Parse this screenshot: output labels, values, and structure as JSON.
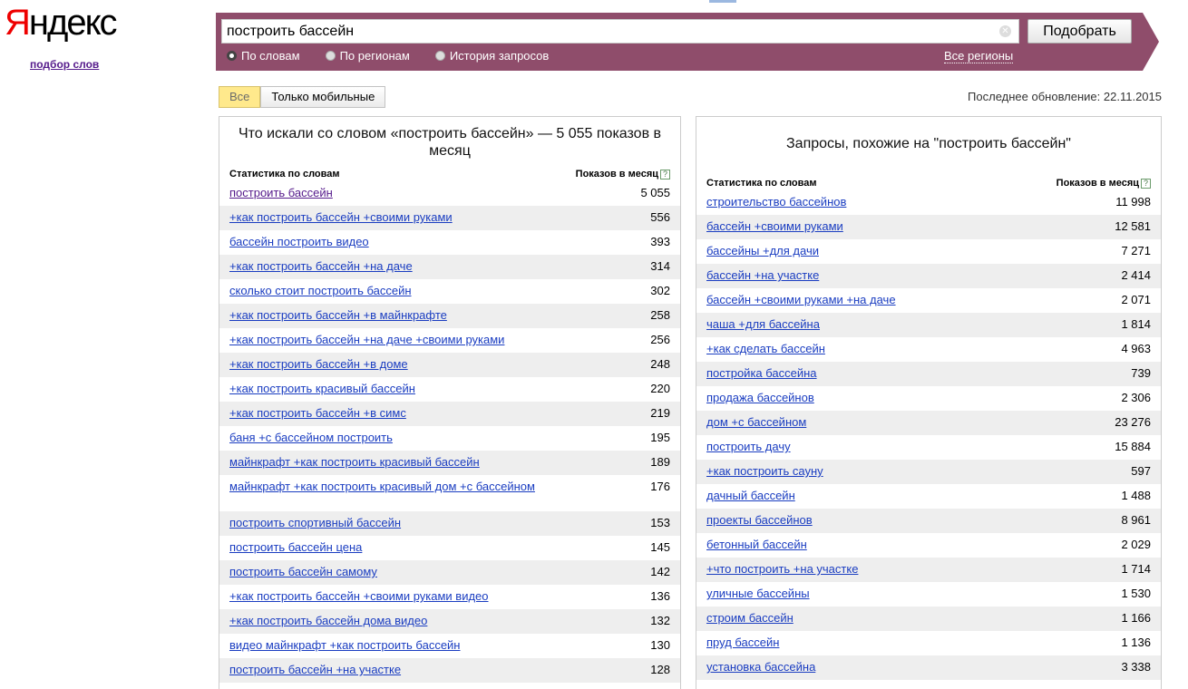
{
  "logo": {
    "first": "Я",
    "rest": "ндекс"
  },
  "sub_link": "подбор слов",
  "search": {
    "value": "построить бассейн",
    "button": "Подобрать"
  },
  "modes": [
    {
      "label": "По словам",
      "selected": true
    },
    {
      "label": "По регионам",
      "selected": false
    },
    {
      "label": "История запросов",
      "selected": false
    }
  ],
  "regions_link": "Все регионы",
  "tabs": [
    "Все",
    "Только мобильные"
  ],
  "updated": "Последнее обновление: 22.11.2015",
  "left": {
    "title": "Что искали со словом «построить бассейн» — 5 055 показов в месяц",
    "col1": "Статистика по словам",
    "col2": "Показов в месяц",
    "rows": [
      {
        "q": "построить бассейн",
        "n": "5 055"
      },
      {
        "q": "+как построить бассейн +своими руками",
        "n": "556"
      },
      {
        "q": "бассейн построить видео",
        "n": "393"
      },
      {
        "q": "+как построить бассейн +на даче",
        "n": "314"
      },
      {
        "q": "сколько стоит построить бассейн",
        "n": "302"
      },
      {
        "q": "+как построить бассейн +в майнкрафте",
        "n": "258"
      },
      {
        "q": "+как построить бассейн +на даче +своими руками",
        "n": "256"
      },
      {
        "q": "+как построить бассейн +в доме",
        "n": "248"
      },
      {
        "q": "+как построить красивый бассейн",
        "n": "220"
      },
      {
        "q": "+как построить бассейн +в симс",
        "n": "219"
      },
      {
        "q": "баня +с бассейном построить",
        "n": "195"
      },
      {
        "q": "майнкрафт +как построить красивый бассейн",
        "n": "189"
      },
      {
        "q": "майнкрафт +как построить красивый дом +с бассейном",
        "n": "176"
      },
      {
        "q": "построить спортивный бассейн",
        "n": "153"
      },
      {
        "q": "построить бассейн цена",
        "n": "145"
      },
      {
        "q": "построить бассейн самому",
        "n": "142"
      },
      {
        "q": "+как построить бассейн +своими руками видео",
        "n": "136"
      },
      {
        "q": "+как построить бассейн дома видео",
        "n": "132"
      },
      {
        "q": "видео майнкрафт +как построить бассейн",
        "n": "130"
      },
      {
        "q": "построить бассейн +на участке",
        "n": "128"
      }
    ]
  },
  "right": {
    "title": "Запросы, похожие на \"построить бассейн\"",
    "col1": "Статистика по словам",
    "col2": "Показов в месяц",
    "rows": [
      {
        "q": "строительство бассейнов",
        "n": "11 998"
      },
      {
        "q": "бассейн +своими руками",
        "n": "12 581"
      },
      {
        "q": "бассейны +для дачи",
        "n": "7 271"
      },
      {
        "q": "бассейн +на участке",
        "n": "2 414"
      },
      {
        "q": "бассейн +своими руками +на даче",
        "n": "2 071"
      },
      {
        "q": "чаша +для бассейна",
        "n": "1 814"
      },
      {
        "q": "+как сделать бассейн",
        "n": "4 963"
      },
      {
        "q": "постройка бассейна",
        "n": "739"
      },
      {
        "q": "продажа бассейнов",
        "n": "2 306"
      },
      {
        "q": "дом +с бассейном",
        "n": "23 276"
      },
      {
        "q": "построить дачу",
        "n": "15 884"
      },
      {
        "q": "+как построить сауну",
        "n": "597"
      },
      {
        "q": "дачный бассейн",
        "n": "1 488"
      },
      {
        "q": "проекты бассейнов",
        "n": "8 961"
      },
      {
        "q": "бетонный бассейн",
        "n": "2 029"
      },
      {
        "q": "+что построить +на участке",
        "n": "1 714"
      },
      {
        "q": "уличные бассейны",
        "n": "1 530"
      },
      {
        "q": "строим бассейн",
        "n": "1 166"
      },
      {
        "q": "пруд бассейн",
        "n": "1 136"
      },
      {
        "q": "установка бассейна",
        "n": "3 338"
      }
    ]
  }
}
